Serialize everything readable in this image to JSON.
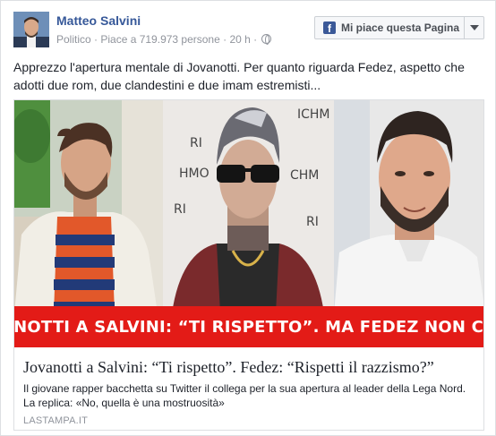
{
  "post": {
    "author": "Matteo Salvini",
    "meta": "Politico · Piace a 719.973 persone · 20 h ·",
    "like_button_label": "Mi piace questa Pagina",
    "text": "Apprezzo l'apertura mentale di Jovanotti. Per quanto riguarda Fedez, aspetto che adotti due rom, due clandestini e due imam estremisti..."
  },
  "link_card": {
    "banner_text": "JOVANOTTI A SALVINI: “TI RISPETTO”. MA FEDEZ NON CI STA",
    "title": "Jovanotti a Salvini: “Ti rispetto”. Fedez: “Rispetti il razzismo?”",
    "description": "Il giovane rapper bacchetta su Twitter il collega per la sua apertura al leader della Lega Nord. La replica: «No, quella è una mostruosità»",
    "domain": "LASTAMPA.IT"
  },
  "colors": {
    "author_link": "#365899",
    "banner_red": "#e31b17",
    "fb_blue": "#3b5998"
  }
}
